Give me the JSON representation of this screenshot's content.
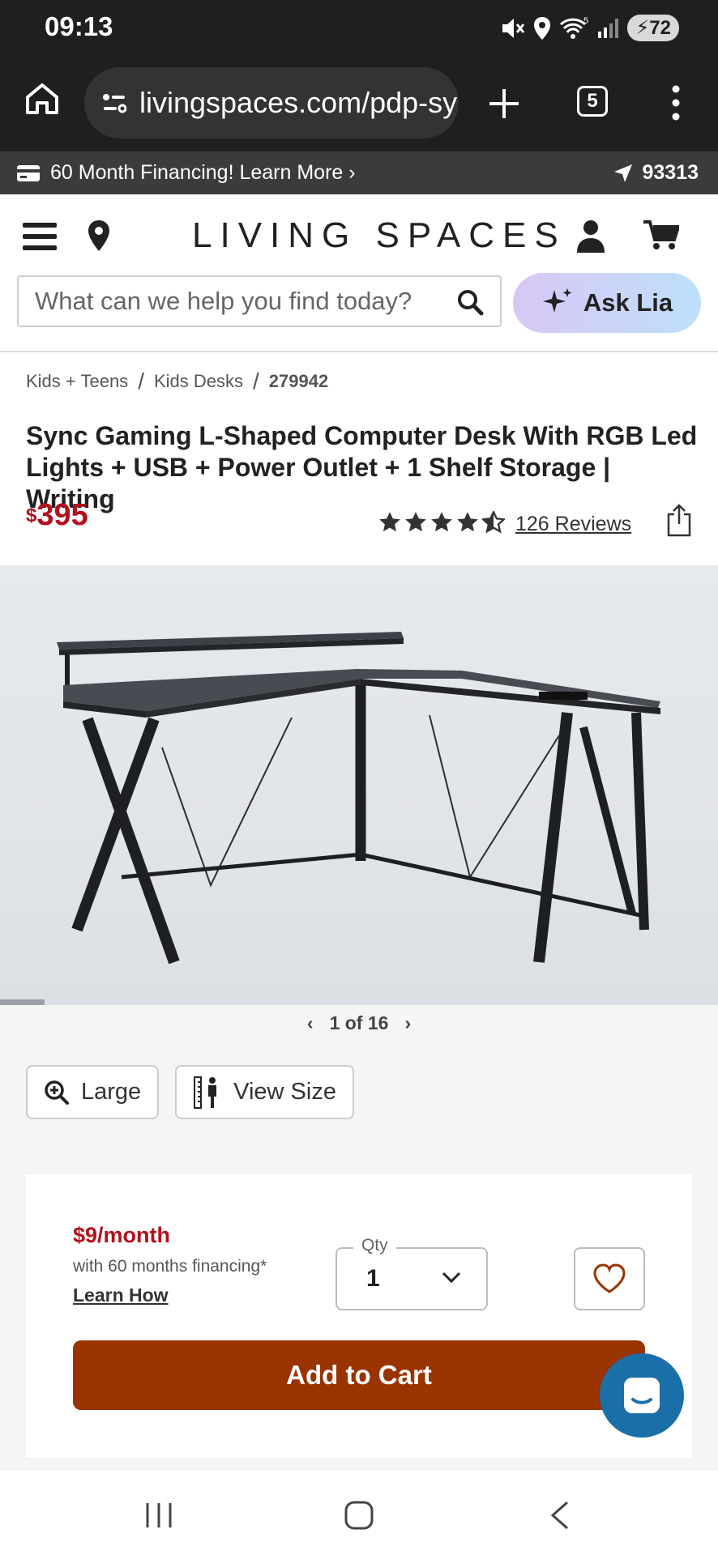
{
  "status_bar": {
    "time": "09:13",
    "network": "5",
    "battery": "72",
    "icons": [
      "mute-icon",
      "location-icon",
      "wifi-icon",
      "signal-icon",
      "battery-icon"
    ]
  },
  "browser": {
    "url": "livingspaces.com/pdp-sy",
    "tab_count": "5"
  },
  "promo": {
    "text": "60 Month Financing! Learn More ›",
    "zip": "93313"
  },
  "header": {
    "logo": "LIVING SPACES",
    "search_placeholder": "What can we help you find today?",
    "ask_label": "Ask Lia"
  },
  "breadcrumb": {
    "items": [
      "Kids + Teens",
      "Kids Desks"
    ],
    "current": "279942",
    "separator": "/"
  },
  "product": {
    "title": "Sync Gaming L-Shaped Computer Desk With RGB Led Lights + USB + Power Outlet + 1 Shelf Storage | Writing",
    "price_currency": "$",
    "price_amount": "395",
    "rating": 4.5,
    "reviews_text": "126 Reviews"
  },
  "gallery": {
    "pager_text": "1 of 16",
    "progress_fraction": 0.0625,
    "large_label": "Large",
    "view_size_label": "View Size"
  },
  "purchase": {
    "monthly": "$9/month",
    "financing_note": "with 60 months financing*",
    "learn_how": "Learn How",
    "qty_label": "Qty",
    "qty_value": "1",
    "add_to_cart": "Add to Cart"
  },
  "colors": {
    "price_red": "#b1121d",
    "cart_button": "#993300",
    "chat_fab": "#1b6fa8",
    "dark_bar": "#1f1f1f"
  }
}
